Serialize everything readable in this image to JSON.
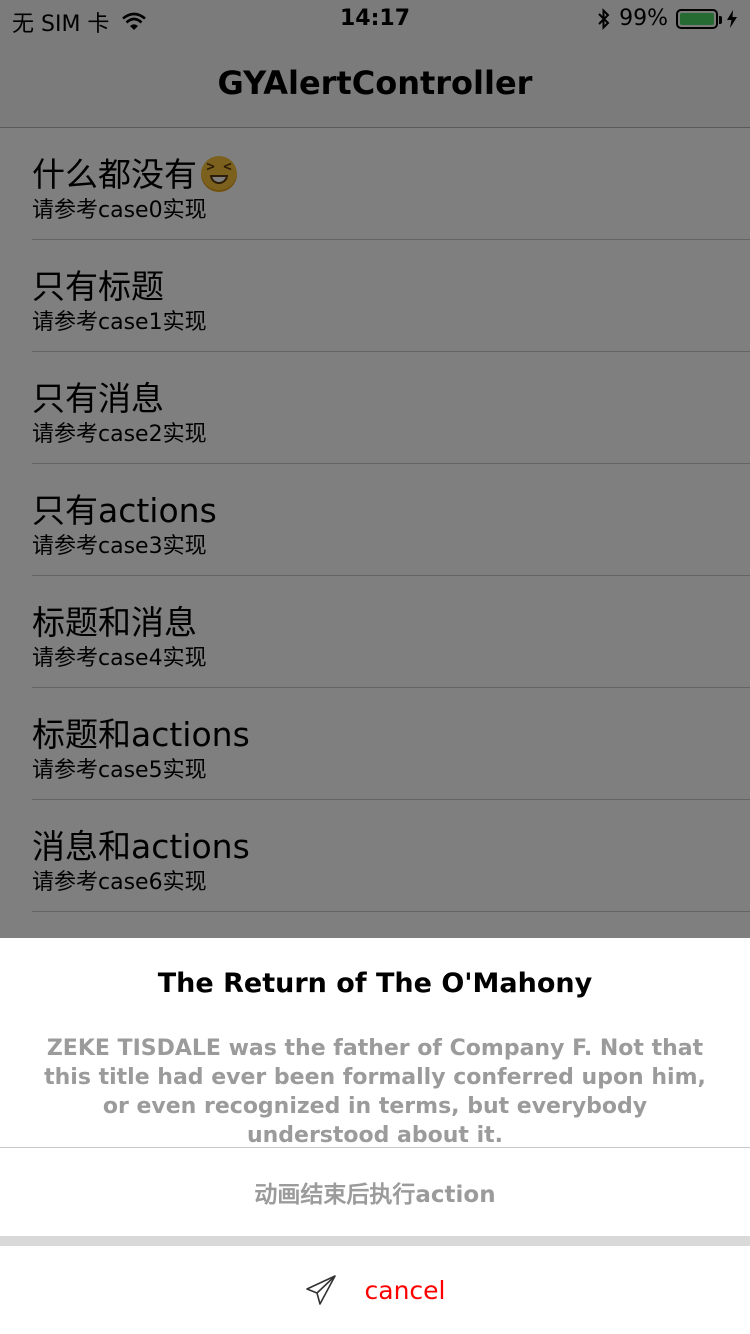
{
  "status_bar": {
    "carrier": "无 SIM 卡",
    "time": "14:17",
    "battery_percent": "99%",
    "battery_level": 0.99,
    "battery_color": "#4cd964",
    "icons": [
      "wifi-icon",
      "bluetooth-icon",
      "battery-icon",
      "charging-bolt-icon"
    ]
  },
  "nav": {
    "title": "GYAlertController"
  },
  "rows": [
    {
      "title": "什么都没有",
      "subtitle": "请参考case0实现",
      "emoji": "laughing-face-icon"
    },
    {
      "title": "只有标题",
      "subtitle": "请参考case1实现"
    },
    {
      "title": "只有消息",
      "subtitle": "请参考case2实现"
    },
    {
      "title": "只有actions",
      "subtitle": "请参考case3实现"
    },
    {
      "title": "标题和消息",
      "subtitle": "请参考case4实现"
    },
    {
      "title": "标题和actions",
      "subtitle": "请参考case5实现"
    },
    {
      "title": "消息和actions",
      "subtitle": "请参考case6实现"
    }
  ],
  "sheet": {
    "title": "The Return of The O'Mahony",
    "message": "ZEKE TISDALE was the father of Company F. Not that this title had ever been formally conferred upon him, or even recognized in terms, but everybody understood about it.",
    "action_label": "动画结束后执行action",
    "cancel_label": "cancel",
    "cancel_icon": "paper-plane-icon",
    "cancel_color": "#ff0000"
  }
}
